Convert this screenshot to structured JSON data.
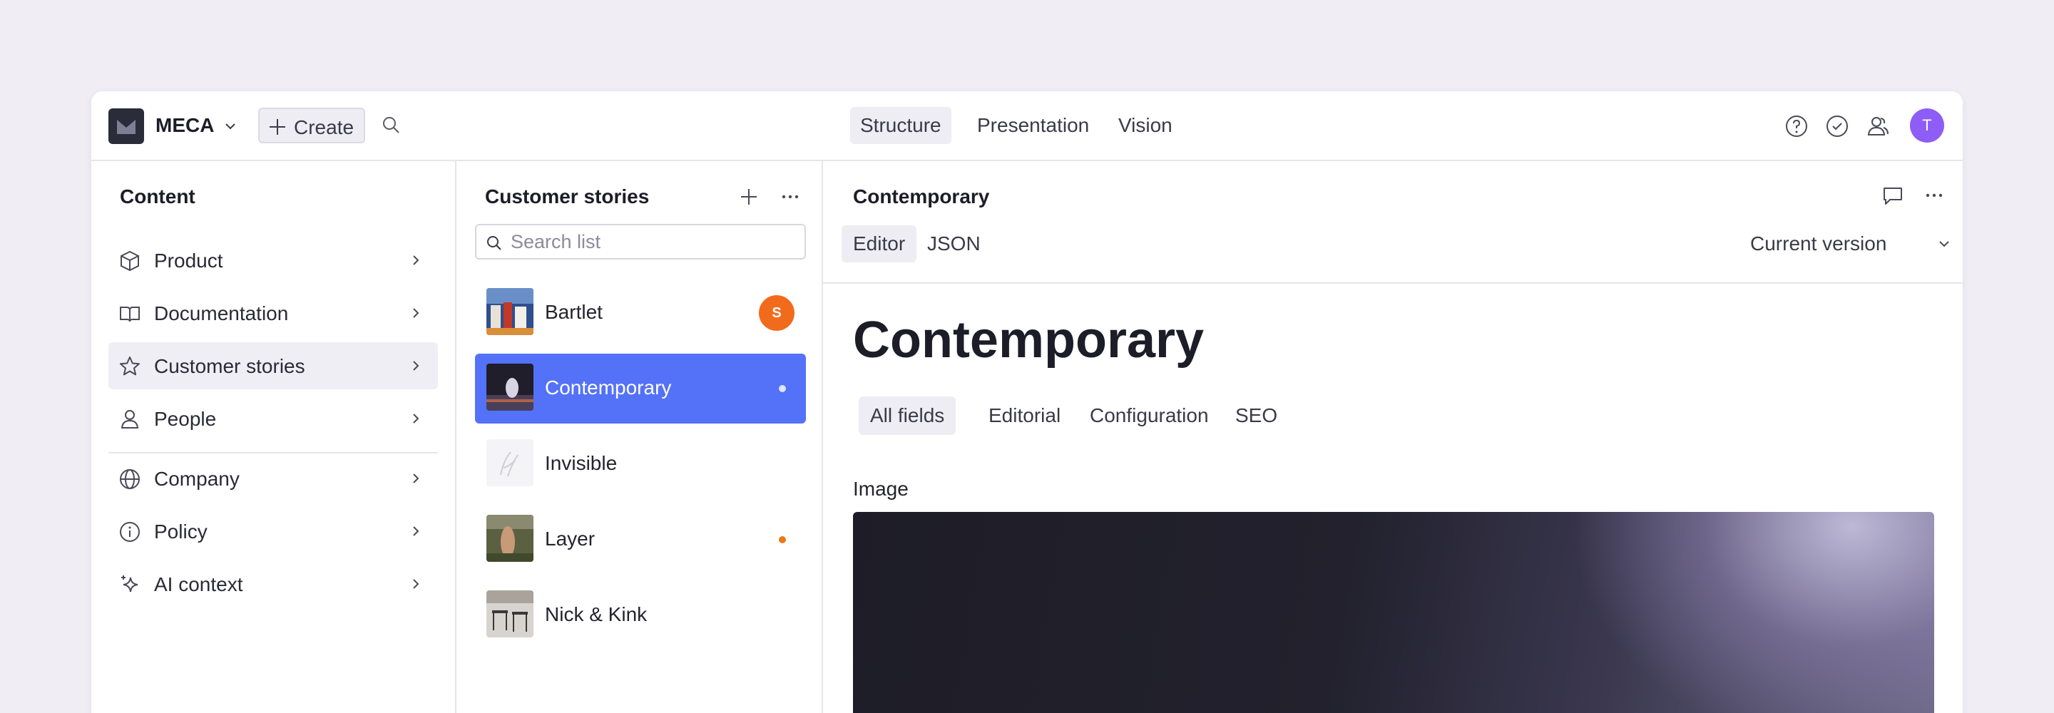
{
  "topbar": {
    "workspace": "MECA",
    "create_label": "Create",
    "tabs": [
      "Structure",
      "Presentation",
      "Vision"
    ],
    "active_tab": "Structure",
    "user_initial": "T"
  },
  "content_pane": {
    "title": "Content",
    "items": [
      {
        "label": "Product",
        "icon": "cube-icon"
      },
      {
        "label": "Documentation",
        "icon": "book-icon"
      },
      {
        "label": "Customer stories",
        "icon": "star-icon",
        "selected": true
      },
      {
        "label": "People",
        "icon": "person-icon"
      },
      {
        "label": "Company",
        "icon": "globe-icon"
      },
      {
        "label": "Policy",
        "icon": "info-icon"
      },
      {
        "label": "AI context",
        "icon": "sparkle-icon"
      }
    ]
  },
  "list_pane": {
    "title": "Customer stories",
    "search_placeholder": "Search list",
    "items": [
      {
        "name": "Bartlet",
        "badge": "S"
      },
      {
        "name": "Contemporary",
        "active": true
      },
      {
        "name": "Invisible"
      },
      {
        "name": "Layer"
      },
      {
        "name": "Nick & Kink"
      }
    ]
  },
  "document": {
    "title": "Contemporary",
    "view_tabs": [
      "Editor",
      "JSON"
    ],
    "version_label": "Current version",
    "heading": "Contemporary",
    "field_tabs": [
      "All fields",
      "Editorial",
      "Configuration",
      "SEO"
    ],
    "image_label": "Image"
  },
  "colors": {
    "accent": "#5472f7",
    "avatar_user": "#8e5cf7",
    "avatar_badge": "#f26b1d",
    "status_changed": "#e8791b"
  }
}
